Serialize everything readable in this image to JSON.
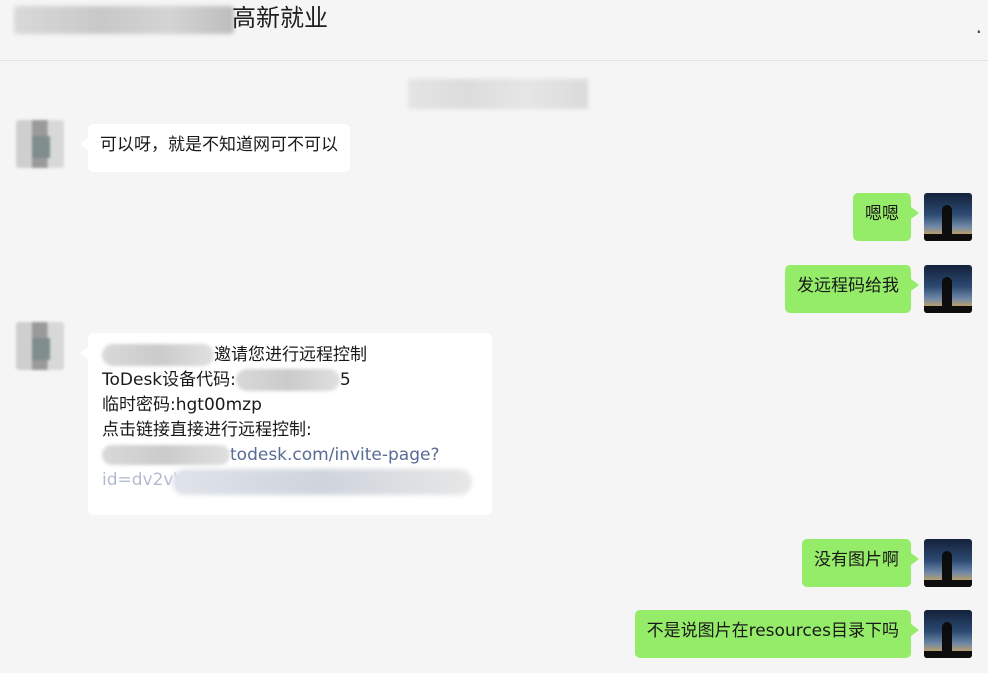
{
  "header": {
    "title": "高新就业",
    "more": "."
  },
  "messages": [
    {
      "side": "left",
      "text": "可以呀，就是不知道网可不可以"
    },
    {
      "side": "right",
      "text": "嗯嗯"
    },
    {
      "side": "right",
      "text": "发远程码给我"
    },
    {
      "side": "left",
      "card": {
        "line1": "邀请您进行远程控制",
        "line2_prefix": "ToDesk设备代码:",
        "line2_suffix": "5",
        "line3": "临时密码:hgt00mzp",
        "line4": "点击链接直接进行远程控制:",
        "link_visible": "todesk.com/invite-page?",
        "link_line2": "id=dv2vWy2"
      }
    },
    {
      "side": "right",
      "text": "没有图片啊"
    },
    {
      "side": "right",
      "text": "不是说图片在resources目录下吗"
    }
  ],
  "colors": {
    "background": "#f5f5f5",
    "self_bubble": "#95ec69",
    "other_bubble": "#ffffff",
    "link": "#576b95"
  }
}
